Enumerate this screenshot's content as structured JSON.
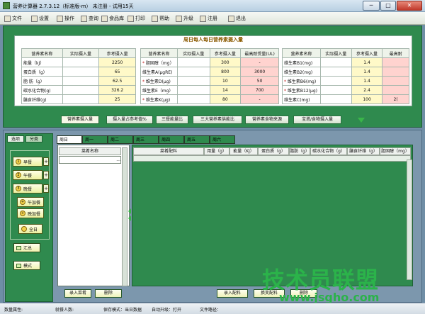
{
  "window": {
    "title": "营养计算器 2.7.3.12（标准版-m） 未注册 - 试用15天",
    "controls": [
      "─",
      "□",
      "✕"
    ]
  },
  "toolbar": {
    "items": [
      {
        "label": "文件",
        "icon": "file-icon"
      },
      {
        "label": "设置",
        "icon": "settings-icon"
      },
      {
        "label": "操作",
        "icon": "operate-icon"
      },
      {
        "label": "查询",
        "icon": "search-icon"
      },
      {
        "label": "食品库",
        "icon": "food-library-icon"
      },
      {
        "label": "打印",
        "icon": "print-icon"
      },
      {
        "label": "帮助",
        "icon": "help-icon"
      },
      {
        "label": "升级",
        "icon": "upgrade-icon"
      },
      {
        "label": "注册",
        "icon": "register-icon"
      },
      {
        "label": "退出",
        "icon": "exit-icon"
      }
    ]
  },
  "intake_sheet": {
    "title": "周日每人每日营养素摄入量",
    "headers": {
      "name": "营养素名称",
      "actual": "实际摄入量",
      "ref": "参考摄入量",
      "max": "最高耐受量(UL)",
      "max_short": "最高耐"
    },
    "col1": [
      {
        "name": "能量（kJ）",
        "actual": "",
        "ref": "2250"
      },
      {
        "name": "蛋白质（g）",
        "actual": "",
        "ref": "65"
      },
      {
        "name": "脂  肪（g）",
        "actual": "",
        "ref": "62.5"
      },
      {
        "name": "碳水化合物(g)",
        "actual": "",
        "ref": "326.2"
      },
      {
        "name": "膳食纤维(g)",
        "actual": "",
        "ref": "25"
      }
    ],
    "col2": [
      {
        "star": true,
        "name": "胆固醇（mg）",
        "actual": "",
        "ref": "300",
        "max": "-"
      },
      {
        "star": false,
        "name": "维生素A(μgRE)",
        "actual": "",
        "ref": "800",
        "max": "3000"
      },
      {
        "star": true,
        "name": "维生素D(μg)",
        "actual": "",
        "ref": "10",
        "max": "50"
      },
      {
        "star": false,
        "name": "维生素E（mg）",
        "actual": "",
        "ref": "14",
        "max": "700"
      },
      {
        "star": true,
        "name": "维生素K(μg)",
        "actual": "",
        "ref": "80",
        "max": "-"
      }
    ],
    "col3": [
      {
        "star": false,
        "name": "维生素B1(mg)",
        "actual": "",
        "ref": "1.4",
        "max": ""
      },
      {
        "star": false,
        "name": "维生素B2(mg)",
        "actual": "",
        "ref": "1.4",
        "max": ""
      },
      {
        "star": true,
        "name": "维生素B6(mg)",
        "actual": "",
        "ref": "1.4",
        "max": ""
      },
      {
        "star": true,
        "name": "维生素B12(μg)",
        "actual": "",
        "ref": "2.4",
        "max": ""
      },
      {
        "star": false,
        "name": "维生素C(mg)",
        "actual": "",
        "ref": "100",
        "max": "2("
      }
    ]
  },
  "sheet_tabs": [
    "营养素摄入量",
    "摄入量占参考值%",
    "三餐能量比",
    "三大营养素供能比",
    "营养素食物来源",
    "宝塔/食物摄入量"
  ],
  "left_panel": {
    "tabs": [
      "选项",
      "分类"
    ],
    "meals": [
      {
        "label": "早餐",
        "badge": "1"
      },
      {
        "label": "午餐",
        "badge": "2"
      },
      {
        "label": "晚餐",
        "badge": "3"
      }
    ],
    "extras": [
      "午加餐",
      "晚加餐"
    ],
    "all_day": "全日",
    "summary": "汇总",
    "mode": "模式",
    "plus": "+"
  },
  "day_tabs": [
    "周日",
    "周一",
    "周二",
    "周三",
    "周四",
    "周五",
    "周六"
  ],
  "dish_list": {
    "header": "菜肴名称",
    "dots": "..."
  },
  "main_grid": {
    "headers": [
      "菜肴配料",
      "用量（g）",
      "能量（Kj）",
      "蛋白质（g）",
      "脂肪（g）",
      "碳水化合物（g）",
      "膳食纤维（g）",
      "胆固醇（mg）"
    ]
  },
  "bottom_buttons": {
    "add_dish": "录入菜肴",
    "delete_dish": "删除",
    "add_ingredient": "录入配料",
    "change_ingredient": "换变配料",
    "delete_ingredient": "删除"
  },
  "status_bar": {
    "attribute": "数量属性:",
    "people": "就餐人数:",
    "save_path": "保存模式：当日数据",
    "auto_upgrade": "自动升级：打开",
    "file_path": "文件路径："
  },
  "watermark": {
    "line1": "技术员联盟",
    "line2": "www.jsgho.com"
  },
  "colors": {
    "panel_green": "#2f8a4e",
    "ref_yellow": "#fff9c8",
    "max_pink": "#ffd3cf",
    "watermark_green": "#2bb34a"
  }
}
